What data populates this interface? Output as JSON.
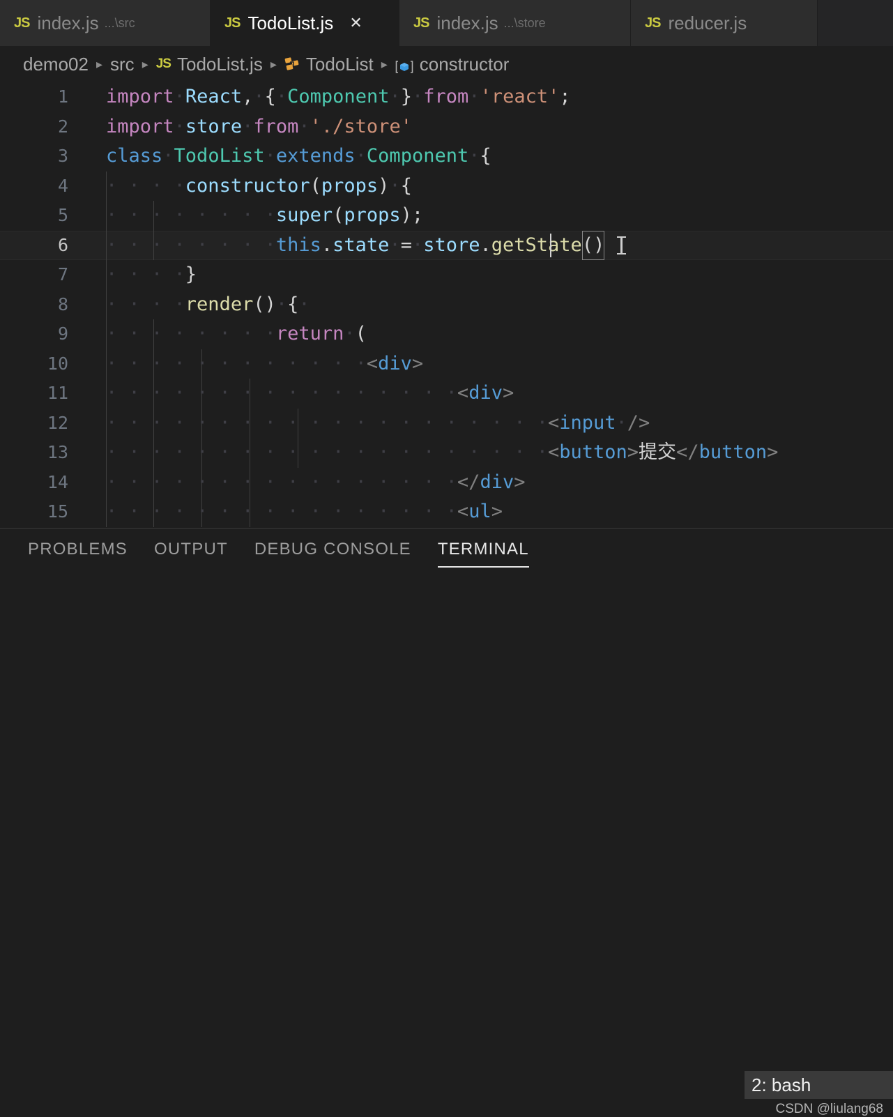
{
  "window": {
    "app": "Visual Studio Code",
    "theme_bg": "#1e1e1e",
    "tabbar_bg": "#252526",
    "accent": "#cbcb41"
  },
  "tabs": [
    {
      "icon": "js-file-icon",
      "name": "index.js",
      "desc": "...\\src",
      "active": false,
      "has_close": false
    },
    {
      "icon": "js-file-icon",
      "name": "TodoList.js",
      "desc": "",
      "active": true,
      "has_close": true,
      "close": "✕"
    },
    {
      "icon": "js-file-icon",
      "name": "index.js",
      "desc": "...\\store",
      "active": false,
      "has_close": false
    },
    {
      "icon": "js-file-icon",
      "name": "reducer.js",
      "desc": "",
      "active": false,
      "has_close": false
    }
  ],
  "tab_icon_label": "JS",
  "breadcrumb": {
    "separator": "▸",
    "items": [
      {
        "label": "demo02",
        "icon": ""
      },
      {
        "label": "src",
        "icon": ""
      },
      {
        "label": "TodoList.js",
        "icon": "js-file-icon"
      },
      {
        "label": "TodoList",
        "icon": "class-symbol-icon"
      },
      {
        "label": "constructor",
        "icon": "constructor-symbol-icon"
      }
    ]
  },
  "editor": {
    "language": "javascript",
    "active_line": 6,
    "cursor": {
      "line": 6,
      "column": 36
    },
    "lines": [
      {
        "n": "1",
        "text": "import React, { Component } from 'react';"
      },
      {
        "n": "2",
        "text": "import store from './store'"
      },
      {
        "n": "3",
        "text": "class TodoList extends Component {"
      },
      {
        "n": "4",
        "text": "    constructor(props) {"
      },
      {
        "n": "5",
        "text": "        super(props);"
      },
      {
        "n": "6",
        "text": "        this.state = store.getState()"
      },
      {
        "n": "7",
        "text": "    }"
      },
      {
        "n": "8",
        "text": "    render() {"
      },
      {
        "n": "9",
        "text": "        return ("
      },
      {
        "n": "10",
        "text": "            <div>"
      },
      {
        "n": "11",
        "text": "                <div>"
      },
      {
        "n": "12",
        "text": "                    <input />"
      },
      {
        "n": "13",
        "text": "                    <button>提交</button>"
      },
      {
        "n": "14",
        "text": "                </div>"
      },
      {
        "n": "15",
        "text": "                <ul>"
      }
    ]
  },
  "panel": {
    "tabs": [
      {
        "label": "PROBLEMS",
        "selected": false
      },
      {
        "label": "OUTPUT",
        "selected": false
      },
      {
        "label": "DEBUG CONSOLE",
        "selected": false
      },
      {
        "label": "TERMINAL",
        "selected": true
      }
    ],
    "terminal_selector": "2: bash"
  },
  "watermark": "CSDN @liulang68"
}
